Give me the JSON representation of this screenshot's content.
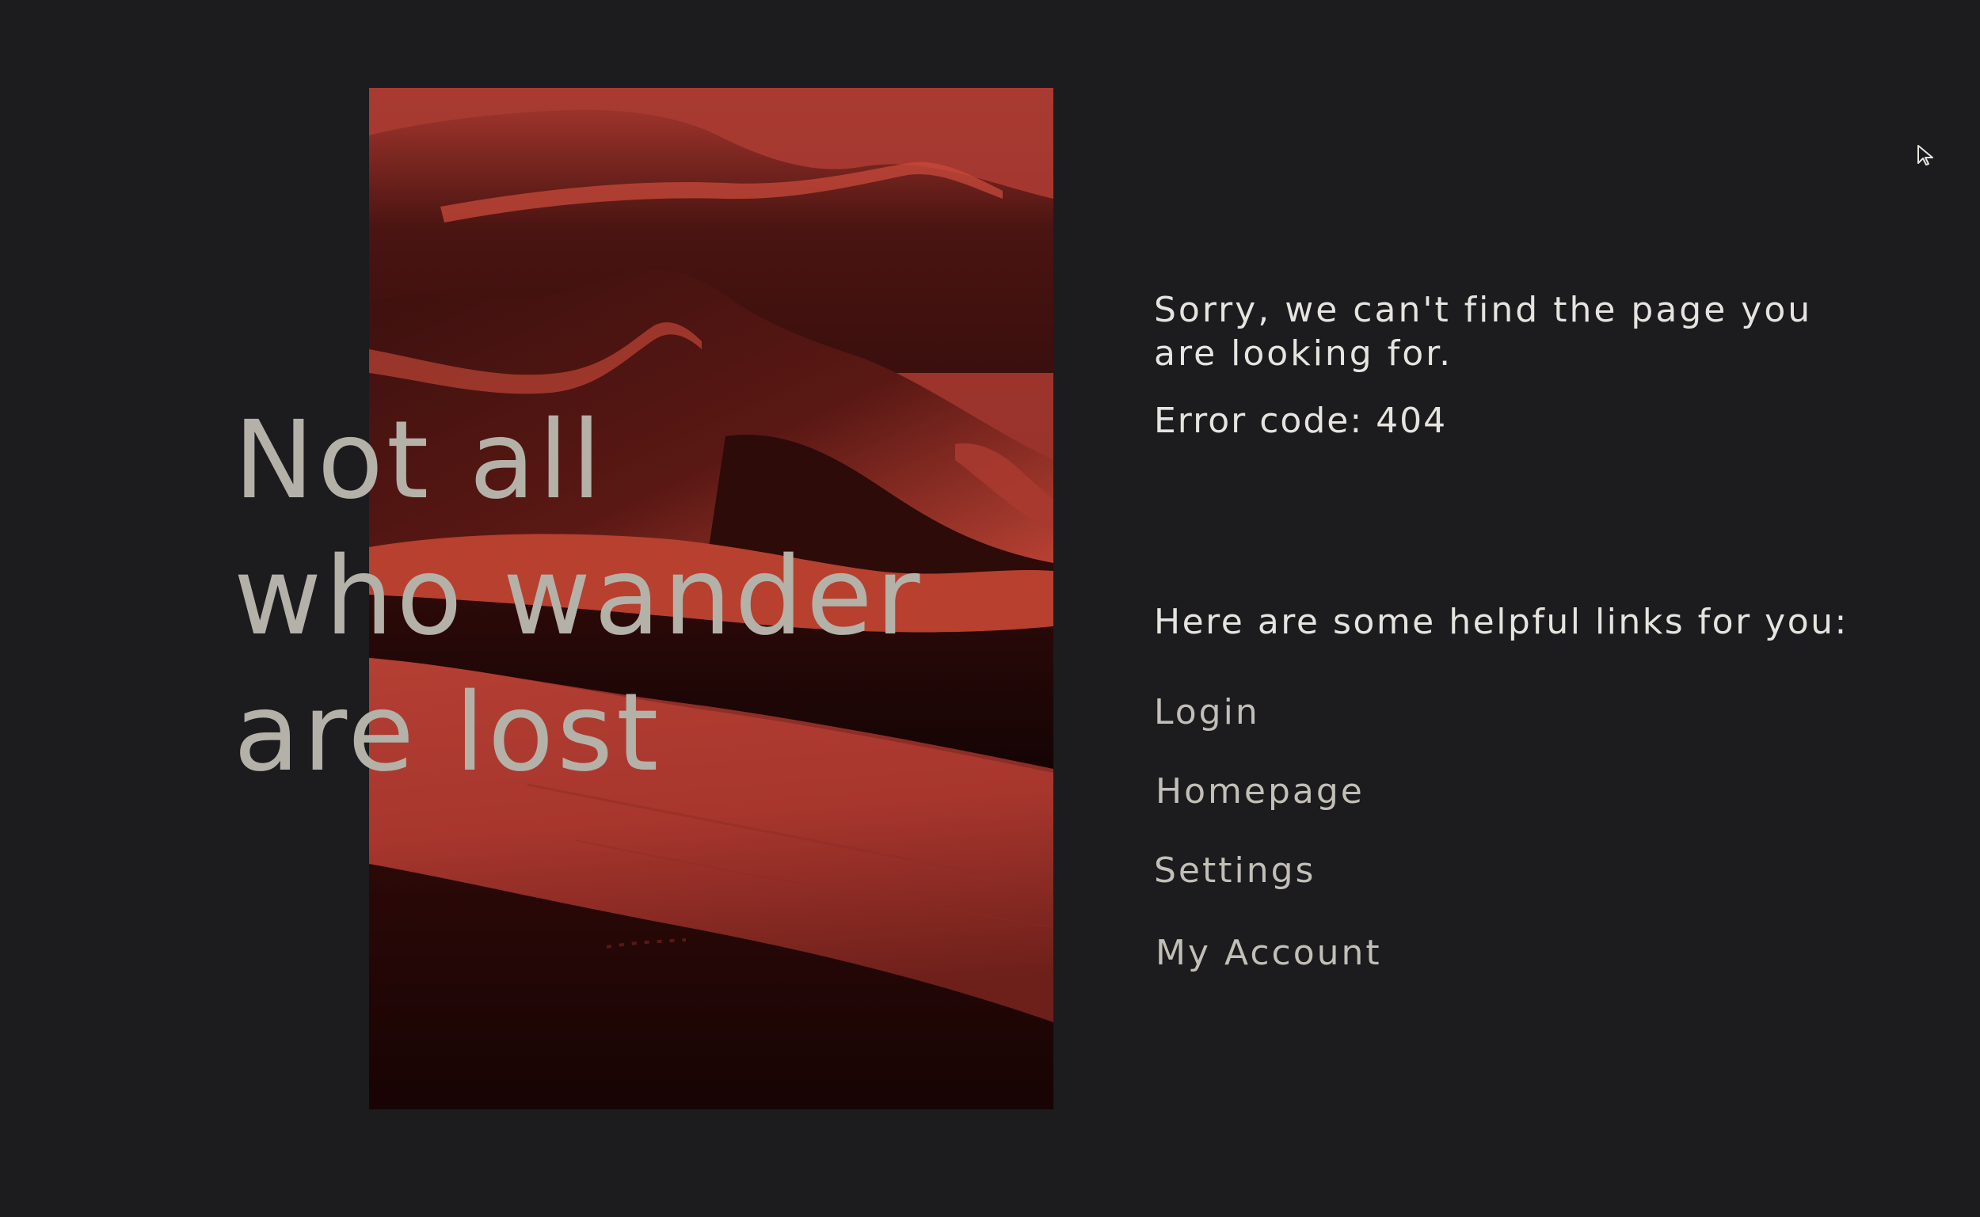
{
  "hero": {
    "headline_lines": [
      "Not all",
      "who wander",
      "are lost"
    ]
  },
  "message": {
    "text": "Sorry, we can't find the page you are looking for.",
    "error_code": "Error code: 404"
  },
  "links": {
    "heading": "Here are some helpful links for you:",
    "items": [
      {
        "label": "Login"
      },
      {
        "label": "Homepage"
      },
      {
        "label": "Settings"
      },
      {
        "label": "My Account"
      }
    ]
  },
  "colors": {
    "background": "#1c1b1e",
    "dune_red": "#b23b31",
    "dune_shadow": "#1d0706",
    "headline_text": "#b4b1a8",
    "body_text": "#e6e4df"
  },
  "icons": {
    "cursor": "mouse-pointer-icon"
  }
}
